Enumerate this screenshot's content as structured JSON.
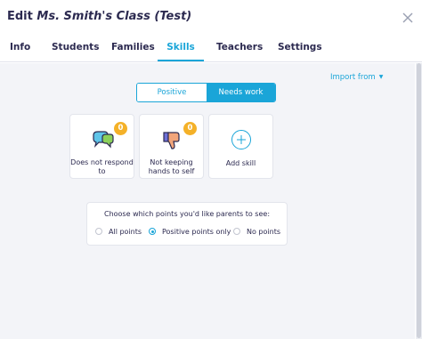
{
  "header": {
    "title_prefix": "Edit",
    "class_name": "Ms. Smith's Class (Test)"
  },
  "tabs": [
    {
      "label": "Info"
    },
    {
      "label": "Students"
    },
    {
      "label": "Families"
    },
    {
      "label": "Skills",
      "active": true
    },
    {
      "label": "Teachers"
    },
    {
      "label": "Settings"
    }
  ],
  "import": {
    "label": "Import from"
  },
  "toggle": {
    "positive_label": "Positive",
    "needs_work_label": "Needs work",
    "selected": "Needs work"
  },
  "skills": [
    {
      "label": "Does not respond to",
      "count": "0",
      "icon": "speech-bubbles-icon"
    },
    {
      "label": "Not keeping hands to self",
      "count": "0",
      "icon": "thumbs-down-icon"
    },
    {
      "label": "Add skill",
      "icon": "plus-circle-icon"
    }
  ],
  "parent_visibility": {
    "prompt": "Choose which points you'd like parents to see:",
    "options": [
      {
        "label": "All points",
        "selected": false
      },
      {
        "label": "Positive points only",
        "selected": true
      },
      {
        "label": "No points",
        "selected": false
      }
    ]
  },
  "colors": {
    "accent": "#1aa5d8",
    "badge": "#f4b128",
    "text": "#2c2a50",
    "content_bg": "#f3f4f8"
  }
}
